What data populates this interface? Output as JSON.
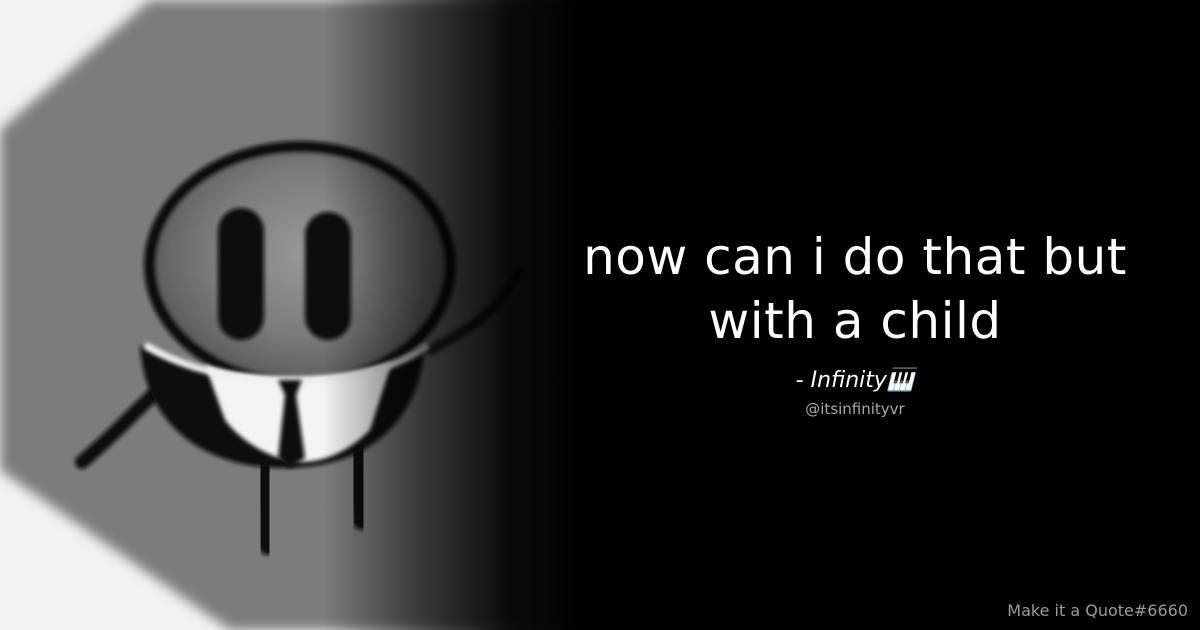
{
  "quote": {
    "text": "now can i do that but\nwith a child",
    "author": "- Infinity🎹",
    "handle": "@itsinfinityvr"
  },
  "watermark": "Make it a Quote#6660",
  "avatar": {
    "description_icon": "suited-blob-character-avatar"
  },
  "colors": {
    "background": "#000000",
    "text": "#ffffff",
    "handle": "#a8a8a8",
    "watermark": "#9a9a9a"
  }
}
